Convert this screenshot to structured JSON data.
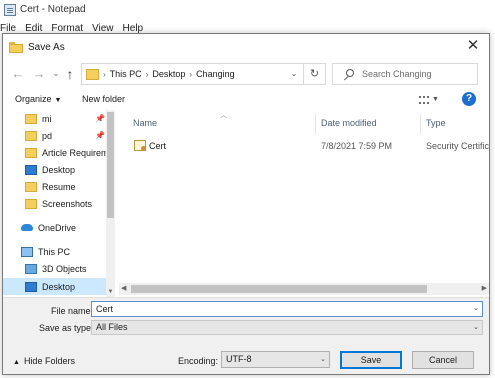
{
  "notepad": {
    "title": "Cert - Notepad",
    "menu": [
      "File",
      "Edit",
      "Format",
      "View",
      "Help"
    ]
  },
  "dialog": {
    "title": "Save As",
    "close_glyph": "✕"
  },
  "address": {
    "segments": [
      "This PC",
      "Desktop",
      "Changing"
    ],
    "search_placeholder": "Search Changing"
  },
  "toolbar": {
    "organize_label": "Organize",
    "new_folder_label": "New folder",
    "help_label": "?"
  },
  "nav_pane": {
    "items": [
      {
        "label": "mi",
        "icon": "folder-icon",
        "pinned": true
      },
      {
        "label": "pd",
        "icon": "folder-icon",
        "pinned": true
      },
      {
        "label": "Article Requirem",
        "icon": "folder-icon",
        "pinned": false
      },
      {
        "label": "Desktop",
        "icon": "desktop-icon",
        "pinned": false
      },
      {
        "label": "Resume",
        "icon": "folder-icon",
        "pinned": false
      },
      {
        "label": "Screenshots",
        "icon": "folder-icon",
        "pinned": false
      },
      {
        "label": "OneDrive",
        "icon": "onedrive-icon",
        "pinned": false
      },
      {
        "label": "This PC",
        "icon": "computer-icon",
        "pinned": false
      },
      {
        "label": "3D Objects",
        "icon": "3d-objects-icon",
        "pinned": false
      },
      {
        "label": "Desktop",
        "icon": "desktop-icon",
        "pinned": false,
        "selected": true
      }
    ]
  },
  "file_list": {
    "columns": [
      "Name",
      "Date modified",
      "Type"
    ],
    "rows": [
      {
        "name": "Cert",
        "date_modified": "7/8/2021 7:59 PM",
        "type": "Security Certificat",
        "icon": "certificate-icon"
      }
    ]
  },
  "form": {
    "file_name_label": "File name:",
    "file_name_value": "Cert",
    "save_as_type_label": "Save as type:",
    "save_as_type_value": "All Files",
    "hide_folders_label": "Hide Folders",
    "encoding_label": "Encoding:",
    "encoding_value": "UTF-8",
    "save_label": "Save",
    "cancel_label": "Cancel"
  },
  "colors": {
    "accent": "#0078d7",
    "selection": "#cce8ff",
    "folder": "#f5cf5e",
    "help_button": "#1c6fd1"
  }
}
